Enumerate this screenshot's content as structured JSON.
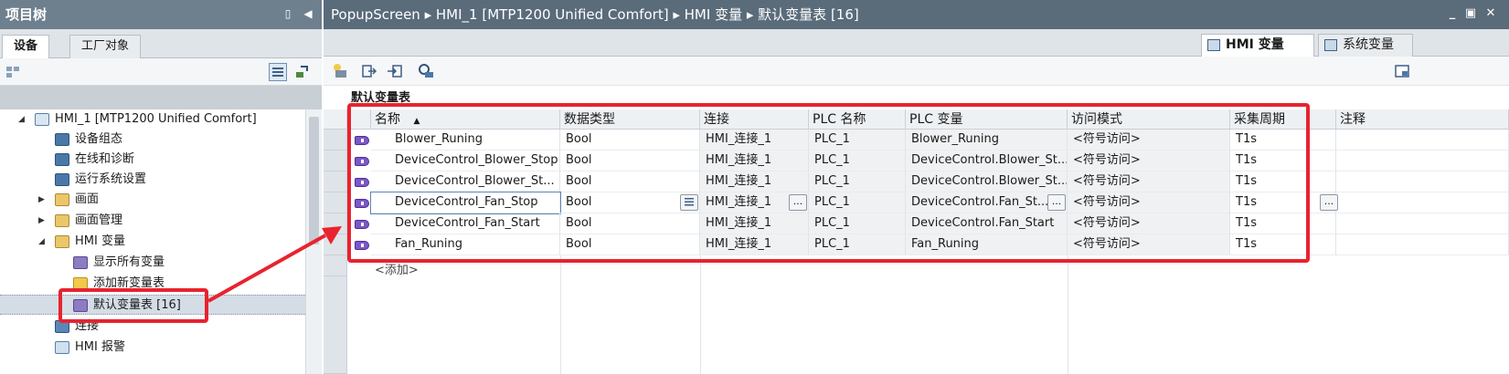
{
  "left_panel": {
    "title": "项目树",
    "tabs": [
      "设备",
      "工厂对象"
    ],
    "tree": [
      {
        "label": "HMI_1 [MTP1200 Unified Comfort]",
        "icon": "hmi-device-icon"
      },
      {
        "label": "设备组态",
        "icon": "device-config-icon"
      },
      {
        "label": "在线和诊断",
        "icon": "diagnostics-icon"
      },
      {
        "label": "运行系统设置",
        "icon": "runtime-settings-icon"
      },
      {
        "label": "画面",
        "icon": "screens-folder-icon"
      },
      {
        "label": "画面管理",
        "icon": "screen-management-icon"
      },
      {
        "label": "HMI 变量",
        "icon": "hmi-tags-folder-icon"
      },
      {
        "label": "显示所有变量",
        "icon": "show-all-tags-icon"
      },
      {
        "label": "添加新变量表",
        "icon": "add-tag-table-icon"
      },
      {
        "label": "默认变量表 [16]",
        "icon": "default-tag-table-icon"
      },
      {
        "label": "连接",
        "icon": "connections-icon"
      },
      {
        "label": "HMI 报警",
        "icon": "hmi-alarms-icon"
      }
    ]
  },
  "editor": {
    "breadcrumb": [
      "PopupScreen",
      "HMI_1 [MTP1200 Unified Comfort]",
      "HMI 变量",
      "默认变量表 [16]"
    ],
    "tabs": [
      "HMI 变量",
      "系统变量"
    ],
    "table_title": "默认变量表",
    "columns": [
      "名称",
      "数据类型",
      "连接",
      "PLC 名称",
      "PLC 变量",
      "访问模式",
      "采集周期",
      "注释"
    ],
    "rows": [
      {
        "name": "Blower_Runing",
        "type": "Bool",
        "connection": "HMI_连接_1",
        "plc": "PLC_1",
        "plc_tag": "Blower_Runing",
        "access": "<符号访问>",
        "cycle": "T1s"
      },
      {
        "name": "DeviceControl_Blower_Stop",
        "type": "Bool",
        "connection": "HMI_连接_1",
        "plc": "PLC_1",
        "plc_tag": "DeviceControl.Blower_St...",
        "access": "<符号访问>",
        "cycle": "T1s"
      },
      {
        "name": "DeviceControl_Blower_St...",
        "type": "Bool",
        "connection": "HMI_连接_1",
        "plc": "PLC_1",
        "plc_tag": "DeviceControl.Blower_St...",
        "access": "<符号访问>",
        "cycle": "T1s"
      },
      {
        "name": "DeviceControl_Fan_Stop",
        "type": "Bool",
        "connection": "HMI_连接_1",
        "plc": "PLC_1",
        "plc_tag": "DeviceControl.Fan_St...",
        "access": "<符号访问>",
        "cycle": "T1s"
      },
      {
        "name": "DeviceControl_Fan_Start",
        "type": "Bool",
        "connection": "HMI_连接_1",
        "plc": "PLC_1",
        "plc_tag": "DeviceControl.Fan_Start",
        "access": "<符号访问>",
        "cycle": "T1s"
      },
      {
        "name": "Fan_Runing",
        "type": "Bool",
        "connection": "HMI_连接_1",
        "plc": "PLC_1",
        "plc_tag": "Fan_Runing",
        "access": "<符号访问>",
        "cycle": "T1s"
      }
    ],
    "add_row": "<添加>",
    "ellipsis": "..."
  },
  "colors": {
    "highlight": "#e8232f",
    "title_bar": "#5a6b7a",
    "tag_icon": "#7b57c7"
  }
}
